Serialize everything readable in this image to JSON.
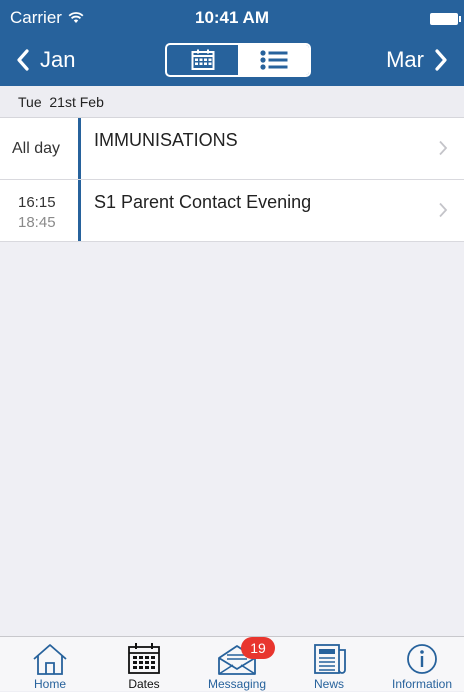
{
  "status_bar": {
    "carrier": "Carrier",
    "time": "10:41 AM"
  },
  "header": {
    "prev_label": "Jan",
    "next_label": "Mar",
    "view_toggle": {
      "calendar_icon": "calendar-icon",
      "list_icon": "list-icon",
      "selected": "list"
    }
  },
  "date_header": "Tue  21st Feb",
  "events": [
    {
      "time_label": "All day",
      "start": "",
      "end": "",
      "title": "IMMUNISATIONS"
    },
    {
      "time_label": "",
      "start": "16:15",
      "end": "18:45",
      "title": "S1 Parent Contact Evening"
    }
  ],
  "tabs": [
    {
      "label": "Home",
      "icon": "home-icon"
    },
    {
      "label": "Dates",
      "icon": "calendar-icon",
      "active": true
    },
    {
      "label": "Messaging",
      "icon": "mail-icon",
      "badge": "19"
    },
    {
      "label": "News",
      "icon": "newspaper-icon"
    },
    {
      "label": "Information",
      "icon": "info-icon"
    }
  ],
  "colors": {
    "brand": "#27629c",
    "badge": "#e8352e",
    "background": "#efeff4"
  }
}
